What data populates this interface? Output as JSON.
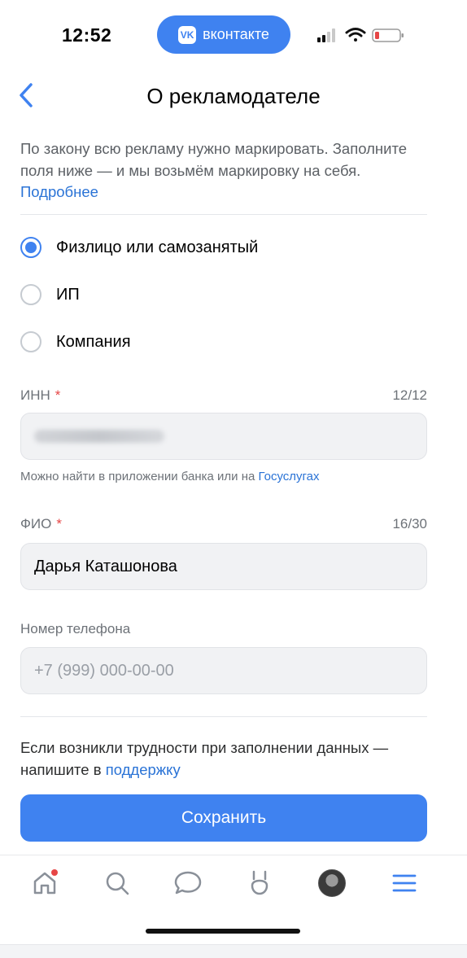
{
  "status_bar": {
    "time": "12:52",
    "app_pill": "вконтакте",
    "vk_logo": "VK"
  },
  "header": {
    "title": "О рекламодателе"
  },
  "intro": {
    "text": "По закону всю рекламу нужно маркировать. Заполните поля ниже — и мы возьмём маркировку на себя. ",
    "link": "Подробнее"
  },
  "advertiser_type": {
    "options": [
      "Физлицо или самозанятый",
      "ИП",
      "Компания"
    ],
    "selected": "Физлицо или самозанятый"
  },
  "inn": {
    "label": "ИНН",
    "required_mark": "*",
    "counter": "12/12",
    "hint_text": "Можно найти в приложении банка или на ",
    "hint_link": "Госуслугах"
  },
  "fio": {
    "label": "ФИО",
    "required_mark": "*",
    "counter": "16/30",
    "value": "Дарья Каташонова"
  },
  "phone": {
    "label": "Номер телефона",
    "placeholder": "+7 (999) 000-00-00"
  },
  "help": {
    "text": "Если возникли трудности при заполнении данных — напишите в ",
    "link": "поддержку"
  },
  "save_label": "Сохранить",
  "tabbar": {
    "icons": [
      "home-icon",
      "search-icon",
      "messenger-icon",
      "clips-icon",
      "avatar",
      "menu-icon"
    ],
    "notification_color": "#e64646"
  },
  "colors": {
    "accent": "#3f82f0",
    "link": "#2a73d6",
    "required": "#e64646"
  }
}
